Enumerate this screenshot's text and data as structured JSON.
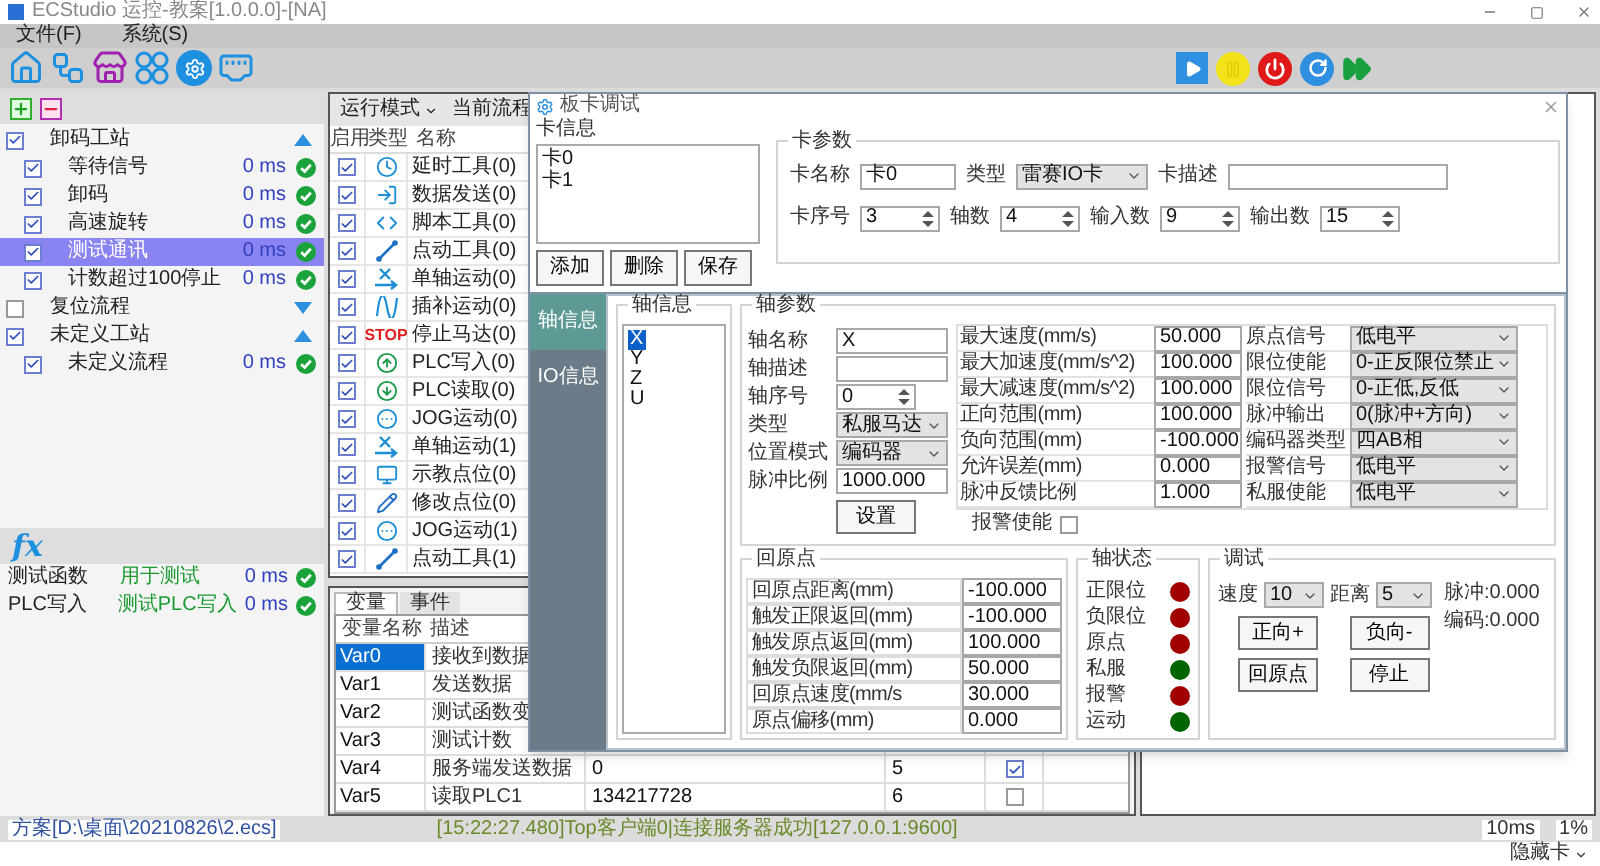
{
  "window": {
    "title": "ECStudio 运控-教案[1.0.0.0]-[NA]"
  },
  "menu": [
    {
      "label": "文件(F)"
    },
    {
      "label": "系统(S)"
    }
  ],
  "stations": [
    {
      "label": "卸码工站",
      "checked": true,
      "expanded": true,
      "selected": false,
      "children": [
        {
          "label": "等待信号",
          "checked": true,
          "selected": false,
          "time": "0 ms"
        },
        {
          "label": "卸码",
          "checked": true,
          "selected": false,
          "time": "0 ms"
        },
        {
          "label": "高速旋转",
          "checked": true,
          "selected": false,
          "time": "0 ms"
        },
        {
          "label": "测试通讯",
          "checked": true,
          "selected": true,
          "time": "0 ms"
        },
        {
          "label": "计数超过100停止",
          "checked": true,
          "selected": false,
          "time": "0 ms"
        }
      ]
    },
    {
      "label": "复位流程",
      "checked": false,
      "expanded": false,
      "selected": false
    },
    {
      "label": "未定义工站",
      "checked": true,
      "expanded": true,
      "selected": false,
      "children": [
        {
          "label": "未定义流程",
          "checked": true,
          "selected": false,
          "time": "0 ms"
        }
      ]
    }
  ],
  "functions": {
    "icon_text": "fx",
    "rows": [
      {
        "name": "测试函数",
        "description": "用于测试",
        "time": "0 ms"
      },
      {
        "name": "PLC写入",
        "description": "测试PLC写入",
        "time": "0 ms"
      }
    ]
  },
  "flow": {
    "mode_button": "运行模式",
    "current": "当前流程",
    "columns": [
      "启用",
      "类型",
      "名称"
    ],
    "rows": [
      {
        "enabled": true,
        "kind": "timer",
        "name": "延时工具(0)"
      },
      {
        "enabled": true,
        "kind": "send",
        "name": "数据发送(0)"
      },
      {
        "enabled": true,
        "kind": "script",
        "name": "脚本工具(0)"
      },
      {
        "enabled": true,
        "kind": "jog-line",
        "name": "点动工具(0)"
      },
      {
        "enabled": true,
        "kind": "axis",
        "name": "单轴运动(0)"
      },
      {
        "enabled": true,
        "kind": "interp",
        "name": "插补运动(0)"
      },
      {
        "enabled": true,
        "kind": "stop",
        "icon_text": "STOP",
        "name": "停止马达(0)"
      },
      {
        "enabled": true,
        "kind": "plc-write",
        "name": "PLC写入(0)"
      },
      {
        "enabled": true,
        "kind": "plc-read",
        "name": "PLC读取(0)"
      },
      {
        "enabled": true,
        "kind": "jog",
        "name": "JOG运动(0)"
      },
      {
        "enabled": true,
        "kind": "axis",
        "name": "单轴运动(1)"
      },
      {
        "enabled": true,
        "kind": "teach",
        "name": "示教点位(0)"
      },
      {
        "enabled": true,
        "kind": "modify",
        "name": "修改点位(0)"
      },
      {
        "enabled": true,
        "kind": "jog",
        "name": "JOG运动(1)"
      },
      {
        "enabled": true,
        "kind": "jog-line",
        "name": "点动工具(1)"
      }
    ]
  },
  "variables": {
    "tabs": [
      {
        "label": "变量",
        "selected": true
      },
      {
        "label": "事件",
        "selected": false
      }
    ],
    "columns": [
      "变量名称",
      "描述"
    ],
    "rows": [
      {
        "name": "Var0",
        "description": "接收到数据",
        "selected": true
      },
      {
        "name": "Var1",
        "description": "发送数据",
        "selected": false
      },
      {
        "name": "Var2",
        "description": "测试函数变",
        "selected": false
      },
      {
        "name": "Var3",
        "description": "测试计数",
        "selected": false
      },
      {
        "name": "Var4",
        "description": "服务端发送数据",
        "column_3": "0",
        "column_4": "5",
        "checked": true,
        "selected": false
      },
      {
        "name": "Var5",
        "description": "读取PLC1",
        "column_3": "134217728",
        "column_4": "6",
        "checked": false,
        "selected": false
      }
    ]
  },
  "dialog": {
    "title": "板卡调试",
    "card_info": {
      "title": "卡信息",
      "cards": [
        {
          "label": "卡0"
        },
        {
          "label": "卡1"
        }
      ],
      "buttons": [
        "添加",
        "删除",
        "保存"
      ]
    },
    "card_params": {
      "title": "卡参数",
      "rows": [
        [
          {
            "label": "卡名称",
            "value": "卡0",
            "kind": "text"
          },
          {
            "label": "类型",
            "value": "雷赛IO卡",
            "kind": "select"
          },
          {
            "label": "卡描述",
            "kind": "wide"
          }
        ],
        [
          {
            "label": "卡序号",
            "value": "3",
            "kind": "spin"
          },
          {
            "label": "轴数",
            "value": "4",
            "kind": "spin"
          },
          {
            "label": "输入数",
            "value": "9",
            "kind": "spin"
          },
          {
            "label": "输出数",
            "value": "15",
            "kind": "spin"
          }
        ]
      ]
    },
    "side_tabs": [
      {
        "label": "轴信息",
        "selected": true
      },
      {
        "label": "IO信息",
        "selected": false
      }
    ],
    "axis_info": {
      "title": "轴信息",
      "axes": [
        {
          "label": "X",
          "selected": true
        },
        {
          "label": "Y",
          "selected": false
        },
        {
          "label": "Z",
          "selected": false
        },
        {
          "label": "U",
          "selected": false
        }
      ]
    },
    "axis_params": {
      "title": "轴参数",
      "fields": [
        {
          "label": "轴名称",
          "value": "X",
          "kind": "text"
        },
        {
          "label": "轴描述",
          "kind": "text"
        },
        {
          "label": "轴序号",
          "value": "0",
          "kind": "spin"
        },
        {
          "label": "类型",
          "value": "私服马达",
          "kind": "select"
        },
        {
          "label": "位置模式",
          "value": "编码器",
          "kind": "select"
        },
        {
          "label": "脉冲比例",
          "value": "1000.000",
          "kind": "text"
        }
      ],
      "set_button": "设置",
      "motion": [
        {
          "label": "最大速度(mm/s)",
          "value": "50.000"
        },
        {
          "label": "最大加速度(mm/s^2)",
          "value": "100.000"
        },
        {
          "label": "最大减速度(mm/s^2)",
          "value": "100.000"
        },
        {
          "label": "正向范围(mm)",
          "value": "100.000"
        },
        {
          "label": "负向范围(mm)",
          "value": "-100.000"
        },
        {
          "label": "允许误差(mm)",
          "value": "0.000"
        },
        {
          "label": "脉冲反馈比例",
          "value": "1.000"
        }
      ],
      "signals": [
        {
          "label": "原点信号",
          "value": "低电平"
        },
        {
          "label": "限位使能",
          "value": "0-正反限位禁止"
        },
        {
          "label": "限位信号",
          "value": "0-正低,反低"
        },
        {
          "label": "脉冲输出",
          "value": "0(脉冲+方向)"
        },
        {
          "label": "编码器类型",
          "value": "四AB相"
        },
        {
          "label": "报警信号",
          "value": "低电平"
        },
        {
          "label": "私服使能",
          "value": "低电平"
        }
      ],
      "alarm_enable": {
        "label": "报警使能",
        "checked": false
      }
    },
    "homing": {
      "title": "回原点",
      "fields": [
        {
          "label": "回原点距离(mm)",
          "value": "-100.000"
        },
        {
          "label": "触发正限返回(mm)",
          "value": "-100.000"
        },
        {
          "label": "触发原点返回(mm)",
          "value": "100.000"
        },
        {
          "label": "触发负限返回(mm)",
          "value": "50.000"
        },
        {
          "label": "回原点速度(mm/s",
          "value": "30.000"
        },
        {
          "label": "原点偏移(mm)",
          "value": "0.000"
        }
      ]
    },
    "axis_status": {
      "title": "轴状态",
      "items": [
        {
          "label": "正限位",
          "color": "#a00000"
        },
        {
          "label": "负限位",
          "color": "#a00000"
        },
        {
          "label": "原点",
          "color": "#a00000"
        },
        {
          "label": "私服",
          "color": "#006400"
        },
        {
          "label": "报警",
          "color": "#a00000"
        },
        {
          "label": "运动",
          "color": "#006400"
        }
      ]
    },
    "jog": {
      "title": "调试",
      "speed_label": "速度",
      "speed": "10",
      "distance_label": "距离",
      "distance": "5",
      "pulse": "脉冲:0.000",
      "encoder": "编码:0.000",
      "buttons": [
        "正向+",
        "负向-",
        "回原点",
        "停止"
      ]
    }
  },
  "status_bar": {
    "project": "方案[D:\\桌面\\20210826\\2.ecs]",
    "log": "[15:22:27.480]Top客户端0|连接服务器成功[127.0.0.1:9600]",
    "cycle": "10ms",
    "load": "1%",
    "card_toggle": "隐藏卡"
  }
}
